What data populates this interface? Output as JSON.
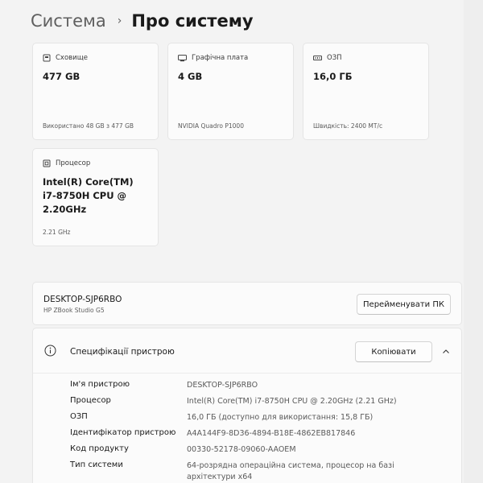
{
  "breadcrumb": {
    "parent": "Система",
    "separator": "›",
    "current": "Про систему"
  },
  "cards": {
    "storage": {
      "label": "Сховище",
      "value": "477 GB",
      "detail": "Використано 48 GB з 477 GB"
    },
    "gpu": {
      "label": "Графічна плата",
      "value": "4 GB",
      "detail": "NVIDIA Quadro P1000"
    },
    "ram": {
      "label": "ОЗП",
      "value": "16,0 ГБ",
      "detail": "Швидкість: 2400 МТ/с"
    },
    "cpu": {
      "label": "Процесор",
      "value": "Intel(R) Core(TM) i7-8750H CPU @ 2.20GHz",
      "detail": "2.21 GHz"
    }
  },
  "device": {
    "name": "DESKTOP-SJP6RBO",
    "model": "HP ZBook Studio G5",
    "rename_label": "Перейменувати ПК"
  },
  "specs": {
    "title": "Специфікації пристрою",
    "copy_label": "Копіювати",
    "rows": [
      {
        "key": "Ім'я пристрою",
        "value": "DESKTOP-SJP6RBO"
      },
      {
        "key": "Процесор",
        "value": "Intel(R) Core(TM) i7-8750H CPU @ 2.20GHz (2.21 GHz)"
      },
      {
        "key": "ОЗП",
        "value": "16,0 ГБ (доступно для використання: 15,8 ГБ)"
      },
      {
        "key": "Ідентифікатор пристрою",
        "value": "A4A144F9-8D36-4894-B18E-4862EB817846"
      },
      {
        "key": "Код продукту",
        "value": "00330-52178-09060-AAOEM"
      },
      {
        "key": "Тип системи",
        "value": "64-розрядна операційна система, процесор на базі архітектури x64"
      }
    ]
  },
  "icons": {
    "storage": "storage-icon",
    "gpu": "gpu-icon",
    "ram": "ram-icon",
    "cpu": "cpu-icon",
    "info": "info-icon",
    "collapse": "chevron-up-icon"
  }
}
